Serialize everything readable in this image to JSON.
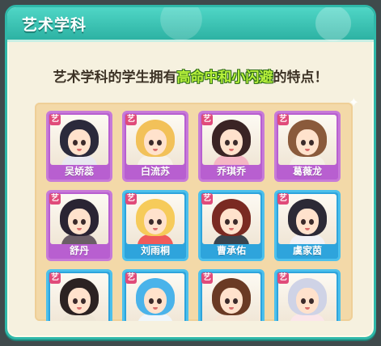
{
  "header": {
    "title": "艺术学科"
  },
  "description": {
    "before": "艺术学科的学生拥有",
    "highlight": "高命中和小闪避",
    "after": "的特点！"
  },
  "colors": {
    "teal": "#2fb8a9",
    "purple_card": "#b85fd0",
    "blue_card": "#2ea4dc",
    "highlight": "#b7f03c"
  },
  "students": [
    {
      "name": "吴娇蕊",
      "badge": "艺",
      "card": "purple",
      "hair": "#2b2a3b",
      "outfit": "#e8e8f0"
    },
    {
      "name": "白流苏",
      "badge": "艺",
      "card": "purple",
      "hair": "#f2c159",
      "outfit": "#f7f2e8"
    },
    {
      "name": "乔琪乔",
      "badge": "艺",
      "card": "purple",
      "hair": "#3a2424",
      "outfit": "#f4b6c4"
    },
    {
      "name": "葛薇龙",
      "badge": "艺",
      "card": "purple",
      "hair": "#8a5a3b",
      "outfit": "#f5f0e6"
    },
    {
      "name": "舒丹",
      "badge": "艺",
      "card": "purple",
      "hair": "#2a2433",
      "outfit": "#6a5e66"
    },
    {
      "name": "刘雨桐",
      "badge": "艺",
      "card": "blue",
      "hair": "#f6cb5a",
      "outfit": "#f05a5a"
    },
    {
      "name": "曹承佑",
      "badge": "艺",
      "card": "blue",
      "hair": "#7a2a22",
      "outfit": "#39444e"
    },
    {
      "name": "虞家茵",
      "badge": "艺",
      "card": "blue",
      "hair": "#2c2a36",
      "outfit": "#f2f2f6"
    },
    {
      "name": "",
      "badge": "艺",
      "card": "blue",
      "hair": "#2b2222",
      "outfit": "#eee6d6"
    },
    {
      "name": "",
      "badge": "艺",
      "card": "blue",
      "hair": "#4ab3ea",
      "outfit": "#f0f6fb"
    },
    {
      "name": "",
      "badge": "艺",
      "card": "blue",
      "hair": "#6a3a24",
      "outfit": "#f6e6d6"
    },
    {
      "name": "",
      "badge": "艺",
      "card": "blue",
      "hair": "#cfd3e6",
      "outfit": "#fbe6ea"
    }
  ]
}
